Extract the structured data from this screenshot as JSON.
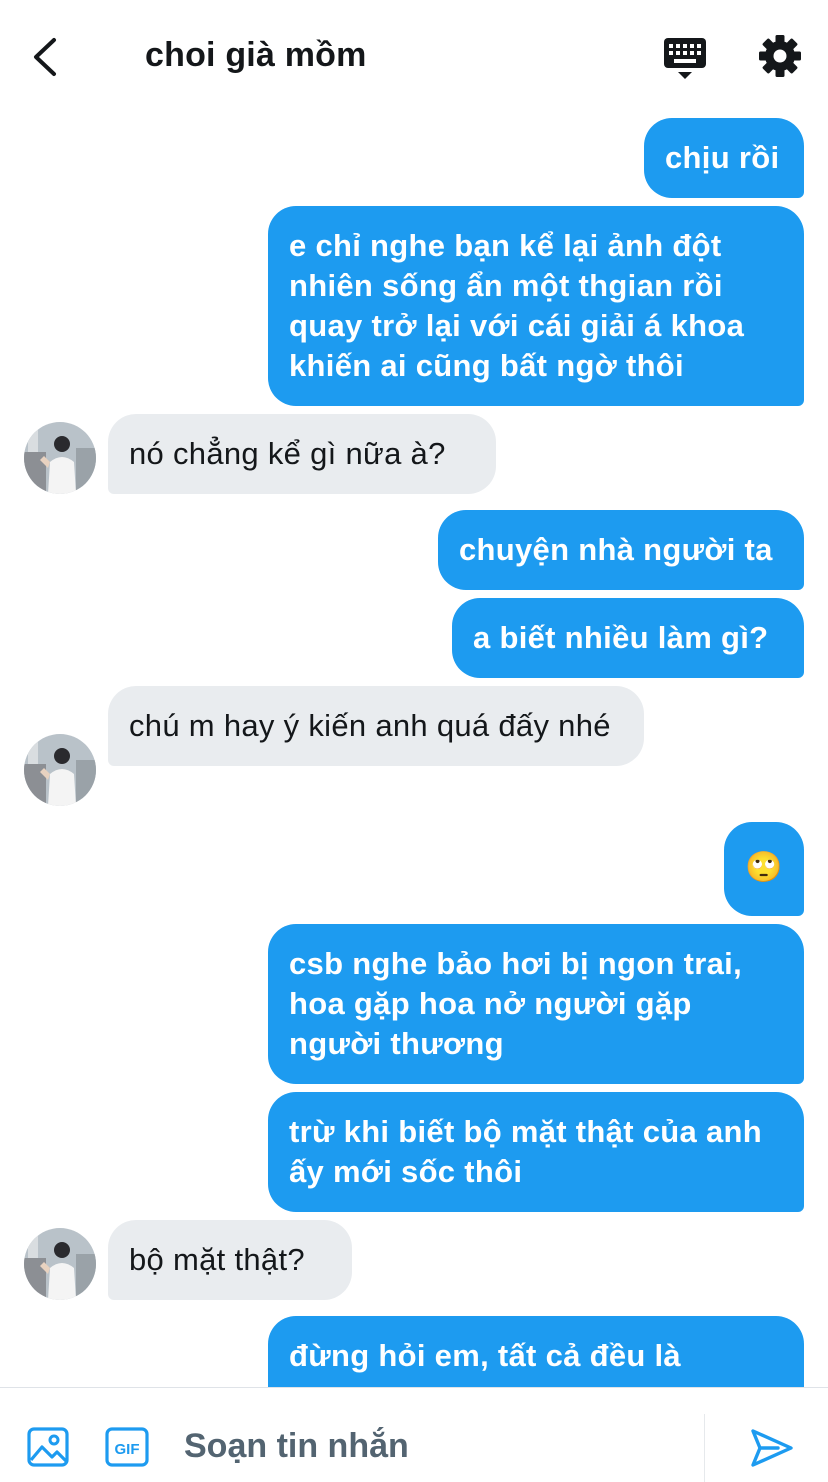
{
  "header": {
    "title": "choi già mồm"
  },
  "messages": [
    {
      "side": "sent",
      "text": "chịu rồi"
    },
    {
      "side": "sent",
      "text": "e chỉ nghe bạn kể lại ảnh đột nhiên sống ẩn một thgian rồi quay trở lại với cái giải á khoa khiến ai cũng bất ngờ thôi"
    },
    {
      "side": "received",
      "text": "nó chẳng kể gì nữa à?"
    },
    {
      "side": "sent",
      "text": "chuyện nhà người ta"
    },
    {
      "side": "sent",
      "text": "a biết nhiều làm gì?"
    },
    {
      "side": "received",
      "text": "chú m hay ý kiến anh quá đấy nhé"
    },
    {
      "side": "sent",
      "text": "🙄"
    },
    {
      "side": "sent",
      "text": "csb nghe bảo hơi bị ngon trai, hoa gặp hoa nở người gặp người thương"
    },
    {
      "side": "sent",
      "text": "trừ khi biết bộ mặt thật của anh ấy mới sốc thôi"
    },
    {
      "side": "received",
      "text": "bộ mặt thật?"
    },
    {
      "side": "sent",
      "text": "đừng hỏi em, tất cả đều là"
    }
  ],
  "composer": {
    "placeholder": "Soạn tin nhắn",
    "gif_label": "GIF"
  },
  "colors": {
    "sent_bubble": "#1d9bf0",
    "received_bubble": "#e9ecef",
    "accent": "#1d9bf0"
  }
}
